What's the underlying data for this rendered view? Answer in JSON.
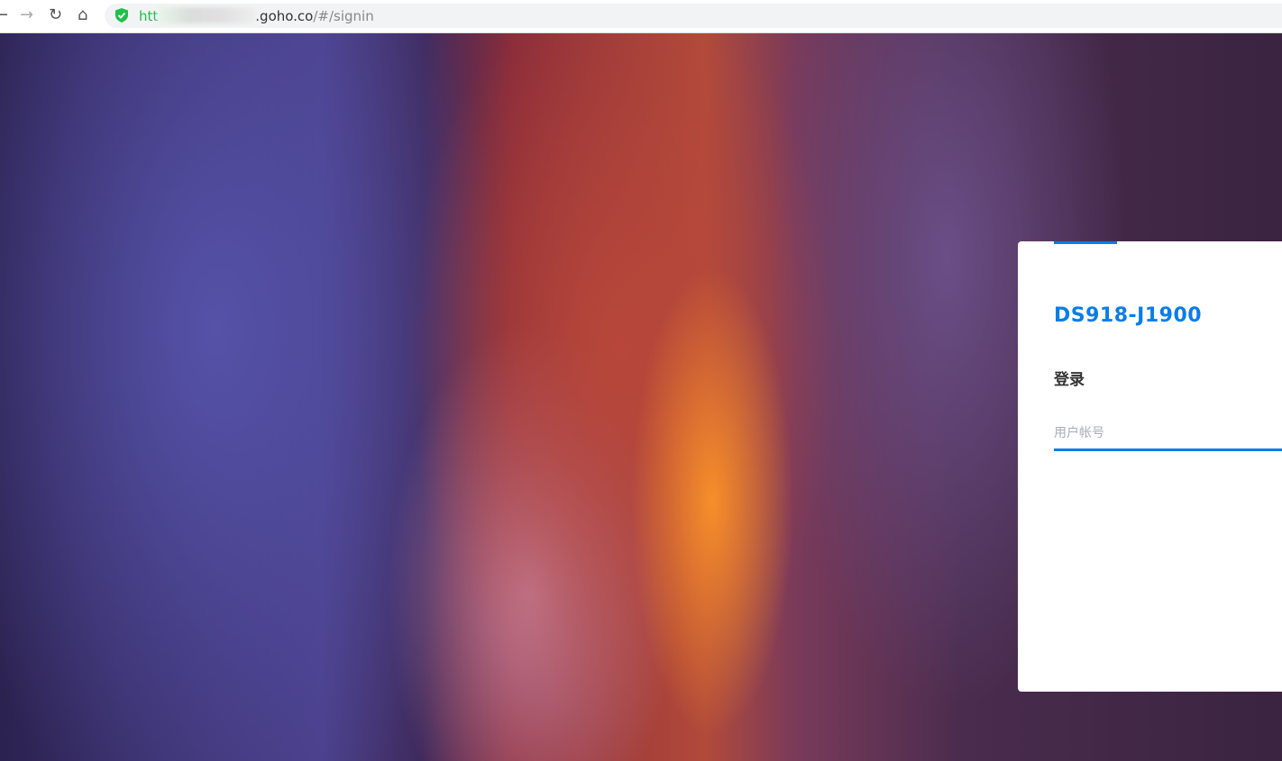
{
  "browser": {
    "url_scheme_visible": "htt",
    "url_host_visible": ".goho.co",
    "url_path": "/#/signin"
  },
  "login": {
    "hostname": "DS918-J1900",
    "title": "登录",
    "username_placeholder": "用户帐号",
    "username_value": ""
  },
  "colors": {
    "accent": "#0a7de8",
    "secure": "#1fbf4a"
  }
}
